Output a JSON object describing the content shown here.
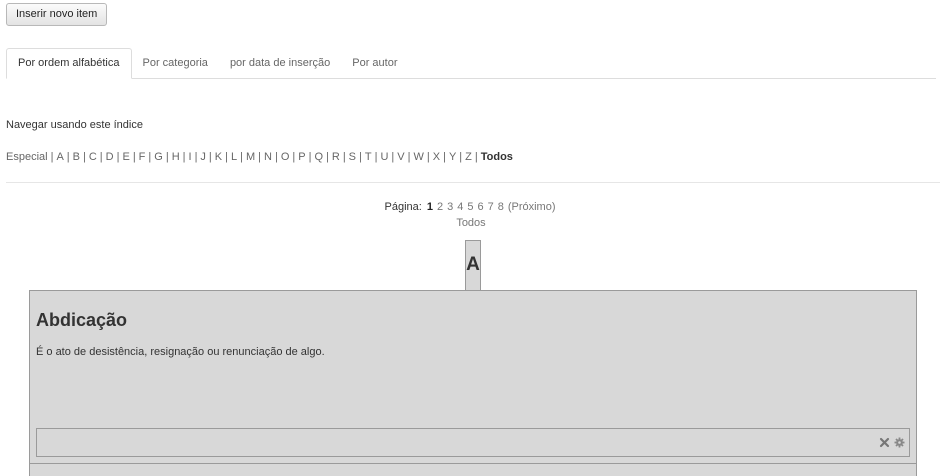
{
  "toolbar": {
    "insert_label": "Inserir novo item"
  },
  "tabs": [
    {
      "label": "Por ordem alfabética",
      "active": true
    },
    {
      "label": "Por categoria",
      "active": false
    },
    {
      "label": "por data de inserção",
      "active": false
    },
    {
      "label": "Por autor",
      "active": false
    }
  ],
  "index": {
    "label": "Navegar usando este índice",
    "special": "Especial",
    "letters": [
      "A",
      "B",
      "C",
      "D",
      "E",
      "F",
      "G",
      "H",
      "I",
      "J",
      "K",
      "L",
      "M",
      "N",
      "O",
      "P",
      "Q",
      "R",
      "S",
      "T",
      "U",
      "V",
      "W",
      "X",
      "Y",
      "Z"
    ],
    "all": "Todos"
  },
  "pagination": {
    "label": "Página:",
    "pages": [
      "1",
      "2",
      "3",
      "4",
      "5",
      "6",
      "7",
      "8"
    ],
    "current": "1",
    "next": "(Próximo)",
    "all": "Todos"
  },
  "section_letter": "A",
  "entry": {
    "title": "Abdicação",
    "description": "É o ato de desistência, resignação ou renunciação de algo.",
    "icons": [
      "delete-icon",
      "settings-icon"
    ]
  }
}
